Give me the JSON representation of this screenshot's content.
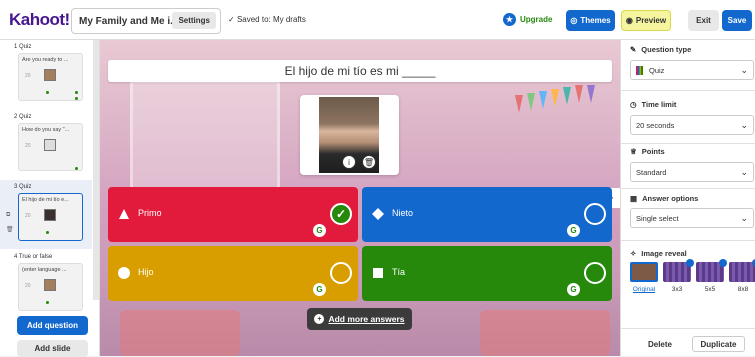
{
  "header": {
    "logo": "Kahoot!",
    "title": "My Family and Me i...",
    "settings_label": "Settings",
    "saved_status": "Saved to: My drafts",
    "upgrade_label": "Upgrade",
    "themes_label": "Themes",
    "preview_label": "Preview",
    "exit_label": "Exit",
    "save_label": "Save"
  },
  "slides": [
    {
      "label": "1 Quiz",
      "text": "Are you ready to ...",
      "image": true
    },
    {
      "label": "2 Quiz",
      "text": "How do you say \"...",
      "image": false
    },
    {
      "label": "3 Quiz",
      "text": "El hijo de mi tío e...",
      "image": true
    },
    {
      "label": "4 True or false",
      "text": "(enter language ...",
      "image": true
    }
  ],
  "sidebar": {
    "add_question_label": "Add question",
    "add_slide_label": "Add slide"
  },
  "question": {
    "text": "El hijo de mi tío es mi _____"
  },
  "answers": [
    {
      "text": "Primo",
      "color": "#e21b3c",
      "shape": "triangle",
      "correct": true
    },
    {
      "text": "Nieto",
      "color": "#1368ce",
      "shape": "diamond",
      "correct": false
    },
    {
      "text": "Hijo",
      "color": "#d89e00",
      "shape": "circle",
      "correct": false
    },
    {
      "text": "Tía",
      "color": "#26890c",
      "shape": "square",
      "correct": false
    }
  ],
  "canvas": {
    "add_more_label": "Add more answers"
  },
  "right_panel": {
    "question_type_label": "Question type",
    "question_type_value": "Quiz",
    "time_limit_label": "Time limit",
    "time_limit_value": "20 seconds",
    "points_label": "Points",
    "points_value": "Standard",
    "answer_options_label": "Answer options",
    "answer_options_value": "Single select",
    "image_reveal_label": "Image reveal",
    "image_reveal_options": [
      "Original",
      "3x3",
      "5x5",
      "8x8"
    ],
    "delete_label": "Delete",
    "duplicate_label": "Duplicate"
  },
  "colors": {
    "brand": "#46178f",
    "blue": "#1368ce",
    "red": "#e21b3c",
    "yellow": "#d89e00",
    "green": "#26890c"
  }
}
